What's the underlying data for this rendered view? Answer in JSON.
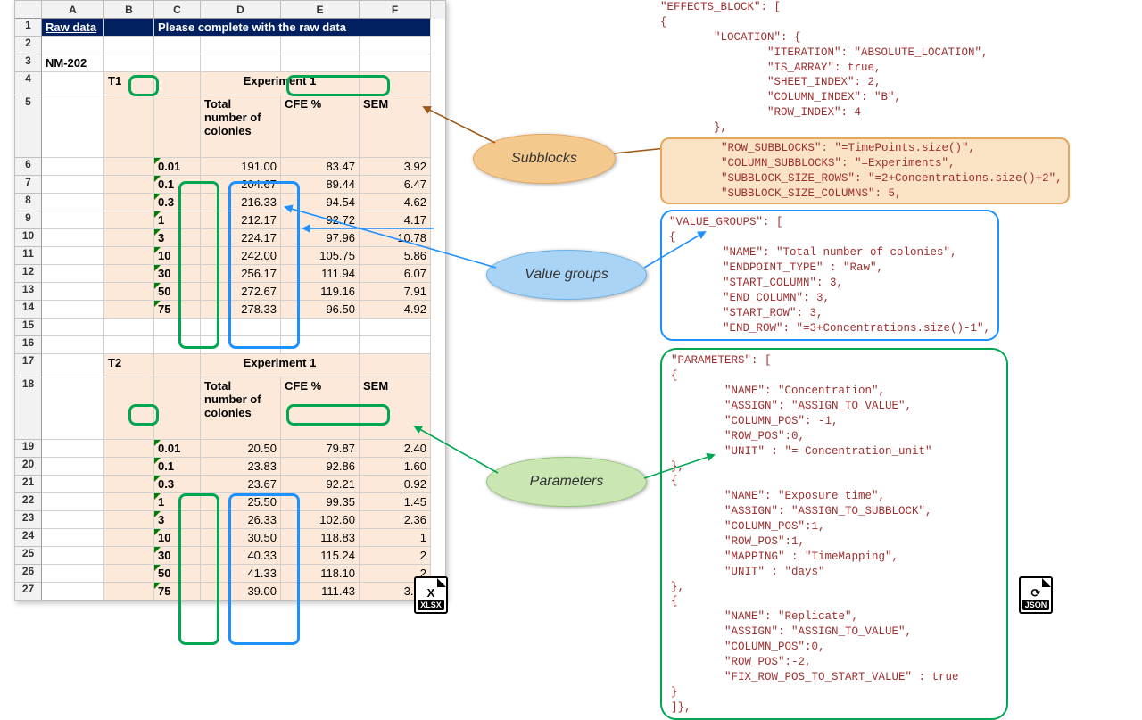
{
  "sheet": {
    "col_letters": [
      "A",
      "B",
      "C",
      "D",
      "E",
      "F"
    ],
    "title_left": "Raw data",
    "title_right": "Please complete with the raw data",
    "material": "NM-202",
    "timepoint1": "T1",
    "timepoint2": "T2",
    "experiment": "Experiment 1",
    "headers": {
      "total": "Total number of colonies",
      "cfe": "CFE %",
      "sem": "SEM"
    },
    "t1": {
      "conc": [
        "0.01",
        "0.1",
        "0.3",
        "1",
        "3",
        "10",
        "30",
        "50",
        "75"
      ],
      "total": [
        "191.00",
        "204.67",
        "216.33",
        "212.17",
        "224.17",
        "242.00",
        "256.17",
        "272.67",
        "278.33"
      ],
      "cfe": [
        "83.47",
        "89.44",
        "94.54",
        "92.72",
        "97.96",
        "105.75",
        "111.94",
        "119.16",
        "96.50"
      ],
      "sem": [
        "3.92",
        "6.47",
        "4.62",
        "4.17",
        "10.78",
        "5.86",
        "6.07",
        "7.91",
        "4.92"
      ]
    },
    "t2": {
      "conc": [
        "0.01",
        "0.1",
        "0.3",
        "1",
        "3",
        "10",
        "30",
        "50",
        "75"
      ],
      "total": [
        "20.50",
        "23.83",
        "23.67",
        "25.50",
        "26.33",
        "30.50",
        "40.33",
        "41.33",
        "39.00"
      ],
      "cfe": [
        "79.87",
        "92.86",
        "92.21",
        "99.35",
        "102.60",
        "118.83",
        "115.24",
        "118.10",
        "111.43"
      ],
      "sem": [
        "2.40",
        "1.60",
        "0.92",
        "1.45",
        "2.36",
        "1",
        "2",
        "2",
        "3.04"
      ]
    }
  },
  "bubbles": {
    "sub": "Subblocks",
    "vg": "Value groups",
    "par": "Parameters"
  },
  "json_lines": {
    "l0": "\"EFFECTS_BLOCK\": [",
    "l1": "{",
    "l2": "        \"LOCATION\": {",
    "l3": "                \"ITERATION\": \"ABSOLUTE_LOCATION\",",
    "l4": "                \"IS_ARRAY\": true,",
    "l5": "                \"SHEET_INDEX\": 2,",
    "l6": "                \"COLUMN_INDEX\": \"B\",",
    "l7": "                \"ROW_INDEX\": 4",
    "l8": "        },",
    "o0": "        \"ROW_SUBBLOCKS\": \"=TimePoints.size()\",",
    "o1": "        \"COLUMN_SUBBLOCKS\": \"=Experiments\",",
    "o2": "        \"SUBBLOCK_SIZE_ROWS\": \"=2+Concentrations.size()+2\",",
    "o3": "        \"SUBBLOCK_SIZE_COLUMNS\": 5,",
    "v0": "\"VALUE_GROUPS\": [",
    "v1": "{",
    "v2": "        \"NAME\": \"Total number of colonies\",",
    "v3": "        \"ENDPOINT_TYPE\" : \"Raw\",",
    "v4": "        \"START_COLUMN\": 3,",
    "v5": "        \"END_COLUMN\": 3,",
    "v6": "        \"START_ROW\": 3,",
    "v7": "        \"END_ROW\": \"=3+Concentrations.size()-1\",",
    "p0": "\"PARAMETERS\": [",
    "p1": "{",
    "p2": "        \"NAME\": \"Concentration\",",
    "p3": "        \"ASSIGN\": \"ASSIGN_TO_VALUE\",",
    "p4": "        \"COLUMN_POS\": -1,",
    "p5": "        \"ROW_POS\":0,",
    "p6": "        \"UNIT\" : \"= Concentration_unit\"",
    "p7": "},",
    "p8": "{",
    "p9": "        \"NAME\": \"Exposure time\",",
    "p10": "        \"ASSIGN\": \"ASSIGN_TO_SUBBLOCK\",",
    "p11": "        \"COLUMN_POS\":1,",
    "p12": "        \"ROW_POS\":1,",
    "p13": "        \"MAPPING\" : \"TimeMapping\",",
    "p14": "        \"UNIT\" : \"days\"",
    "p15": "},",
    "p16": "{",
    "p17": "        \"NAME\": \"Replicate\",",
    "p18": "        \"ASSIGN\": \"ASSIGN_TO_VALUE\",",
    "p19": "        \"COLUMN_POS\":0,",
    "p20": "        \"ROW_POS\":-2,",
    "p21": "        \"FIX_ROW_POS_TO_START_VALUE\" : true",
    "p22": "}",
    "p23": "]},"
  },
  "badge_xlsx": "XLSX",
  "badge_json": "JSON"
}
